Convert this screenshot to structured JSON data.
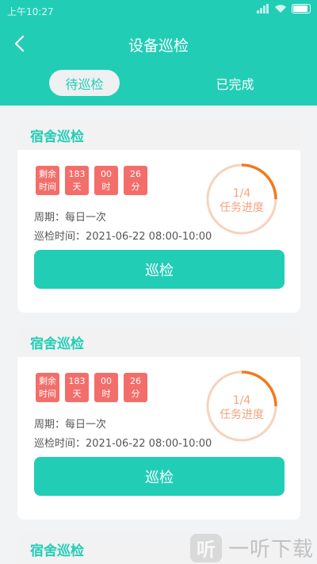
{
  "status": {
    "time": "上午10:27"
  },
  "header": {
    "title": "设备巡检"
  },
  "tabs": [
    {
      "label": "待巡检",
      "active": true
    },
    {
      "label": "已完成",
      "active": false
    }
  ],
  "cards": [
    {
      "title": "宿舍巡检",
      "countdown": [
        {
          "top": "剩余",
          "bottom": "时间"
        },
        {
          "top": "183",
          "bottom": "天"
        },
        {
          "top": "00",
          "bottom": "时"
        },
        {
          "top": "26",
          "bottom": "分"
        }
      ],
      "period": "周期：每日一次",
      "inspect_time": "巡检时间：2021-06-22 08:00-10:00",
      "progress_fraction": "1/4",
      "progress_label": "任务进度",
      "progress_value": 0.25,
      "button_label": "巡检"
    },
    {
      "title": "宿舍巡检",
      "countdown": [
        {
          "top": "剩余",
          "bottom": "时间"
        },
        {
          "top": "183",
          "bottom": "天"
        },
        {
          "top": "00",
          "bottom": "时"
        },
        {
          "top": "26",
          "bottom": "分"
        }
      ],
      "period": "周期：每日一次",
      "inspect_time": "巡检时间：2021-06-22 08:00-10:00",
      "progress_fraction": "1/4",
      "progress_label": "任务进度",
      "progress_value": 0.25,
      "button_label": "巡检"
    },
    {
      "title": "宿舍巡检"
    }
  ],
  "watermark": {
    "logo": "听",
    "text": "一听下载"
  },
  "colors": {
    "accent": "#22cdb6",
    "chip": "#f36e6a",
    "ring_track": "#f7d2bd",
    "ring_fill": "#f07a1e"
  }
}
